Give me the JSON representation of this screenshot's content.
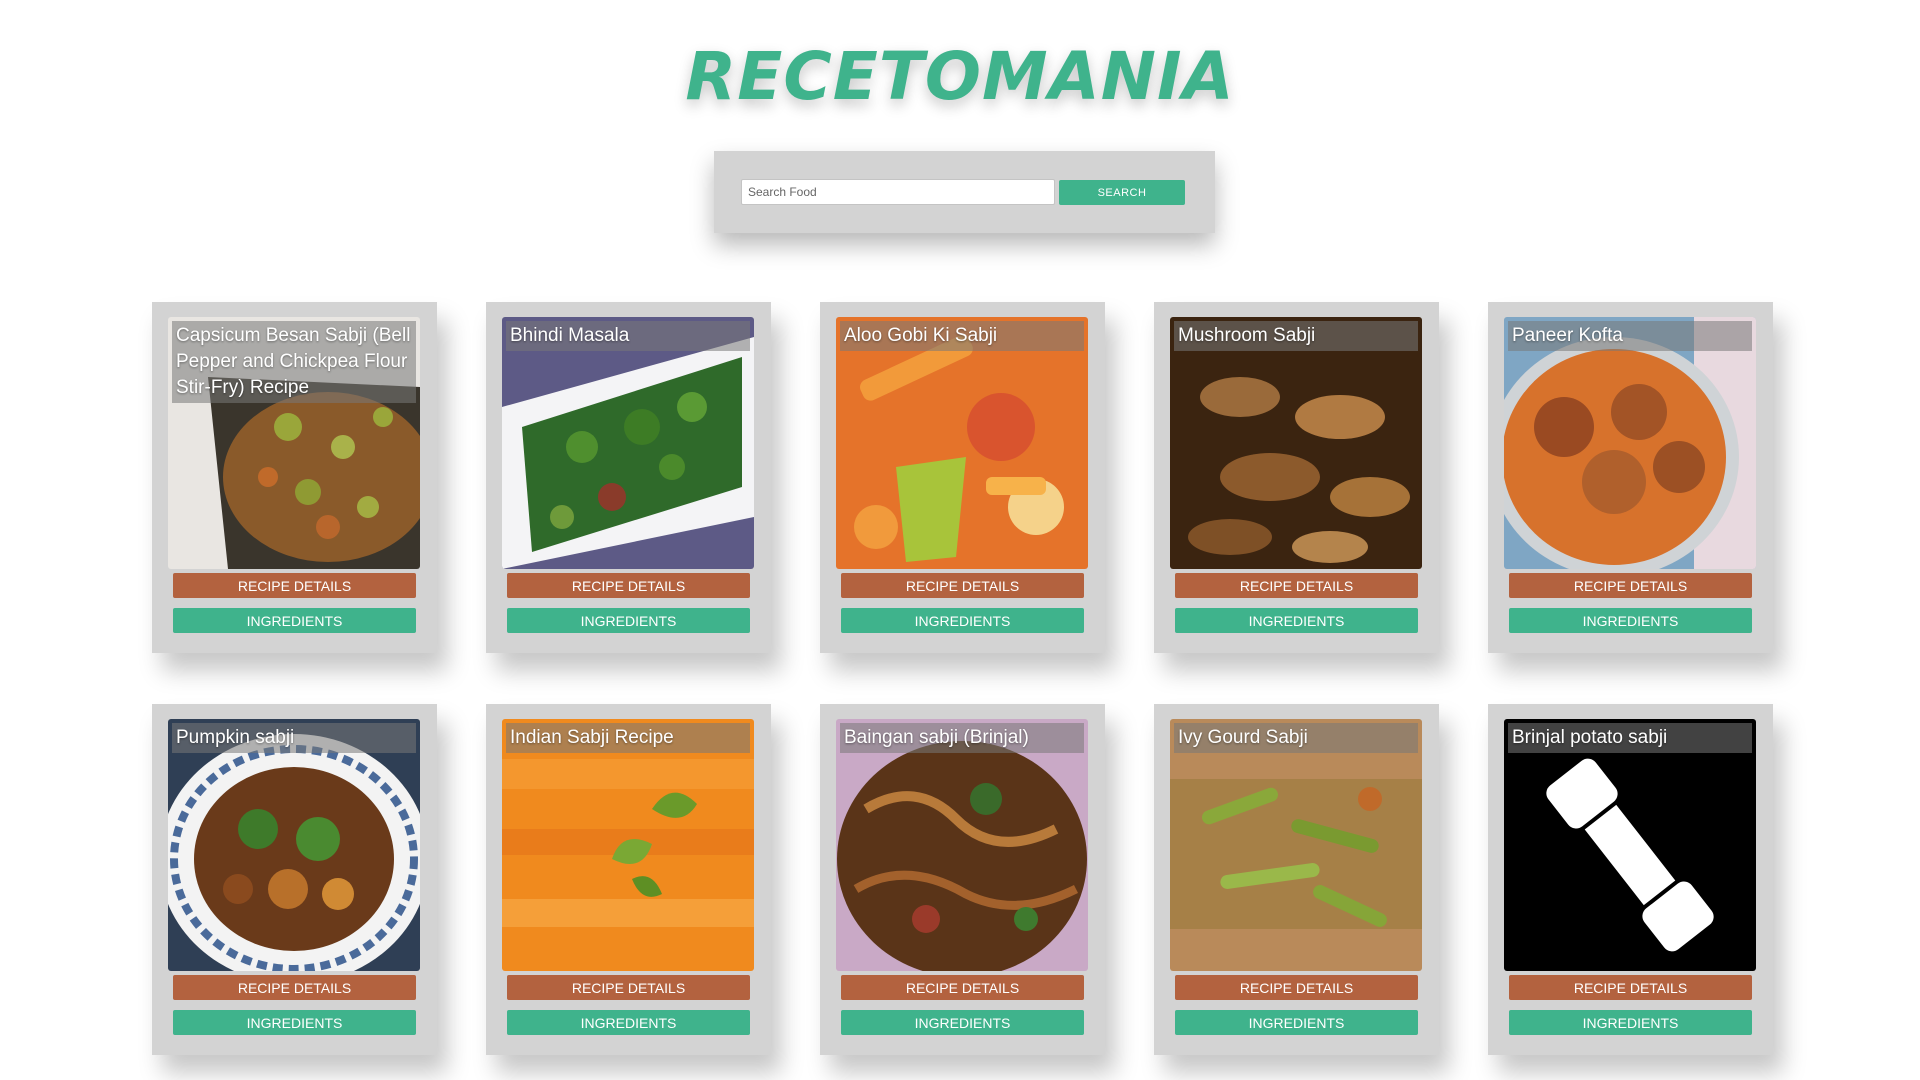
{
  "app": {
    "title": "RECETOMANIA"
  },
  "search": {
    "placeholder": "Search Food",
    "value": "",
    "button_label": "SEARCH"
  },
  "colors": {
    "accent": "#3fb38c",
    "details_button": "#b3623f",
    "card_background": "#d3d3d3"
  },
  "recipes": [
    {
      "title": "Capsicum Besan Sabji (Bell Pepper and Chickpea Flour Stir-Fry) Recipe",
      "image": "capsicum-besan-sabji-photo",
      "details_label": "RECIPE DETAILS",
      "ingredients_label": "INGREDIENTS"
    },
    {
      "title": "Bhindi Masala",
      "image": "bhindi-masala-photo",
      "details_label": "RECIPE DETAILS",
      "ingredients_label": "INGREDIENTS"
    },
    {
      "title": "Aloo Gobi Ki Sabji",
      "image": "aloo-gobi-sabji-photo",
      "details_label": "RECIPE DETAILS",
      "ingredients_label": "INGREDIENTS"
    },
    {
      "title": "Mushroom Sabji",
      "image": "mushroom-sabji-photo",
      "details_label": "RECIPE DETAILS",
      "ingredients_label": "INGREDIENTS"
    },
    {
      "title": "Paneer Kofta",
      "image": "paneer-kofta-photo",
      "details_label": "RECIPE DETAILS",
      "ingredients_label": "INGREDIENTS"
    },
    {
      "title": "Pumpkin sabji",
      "image": "pumpkin-sabji-photo",
      "details_label": "RECIPE DETAILS",
      "ingredients_label": "INGREDIENTS"
    },
    {
      "title": "Indian Sabji Recipe",
      "image": "indian-sabji-photo",
      "details_label": "RECIPE DETAILS",
      "ingredients_label": "INGREDIENTS"
    },
    {
      "title": "Baingan sabji (Brinjal)",
      "image": "baingan-sabji-photo",
      "details_label": "RECIPE DETAILS",
      "ingredients_label": "INGREDIENTS"
    },
    {
      "title": "Ivy Gourd Sabji",
      "image": "ivy-gourd-sabji-photo",
      "details_label": "RECIPE DETAILS",
      "ingredients_label": "INGREDIENTS"
    },
    {
      "title": "Brinjal potato sabji",
      "image": "phone-icon",
      "details_label": "RECIPE DETAILS",
      "ingredients_label": "INGREDIENTS"
    }
  ]
}
